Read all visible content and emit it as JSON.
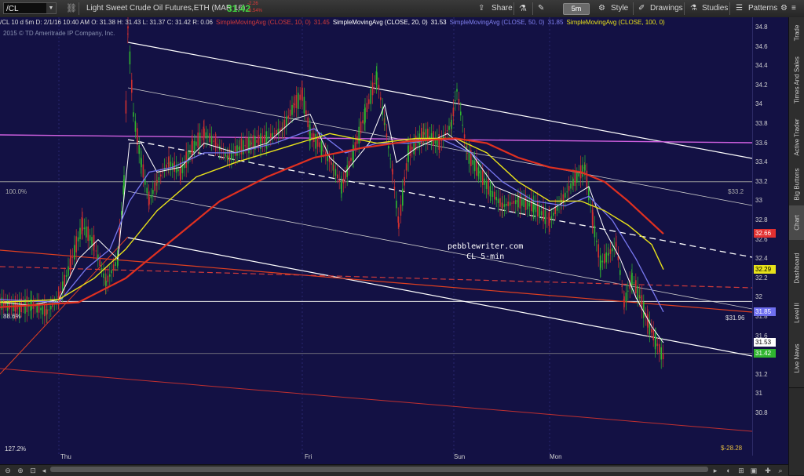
{
  "toolbar": {
    "symbol": "/CL",
    "description": "Light Sweet Crude Oil Futures,ETH (MAR 16)",
    "price": "31.42",
    "change_abs": "-2.26",
    "change_pct": "-6.54%",
    "share_label": "Share",
    "timeframe": "5m",
    "style_label": "Style",
    "drawings_label": "Drawings",
    "studies_label": "Studies",
    "patterns_label": "Patterns"
  },
  "infobar": {
    "ohlc": "/CL 10 d 5m  D: 2/1/16 10:40 AM  O: 31.38  H: 31.43  L: 31.37  C: 31.42  R: 0.06",
    "sma10": "SimpleMovingAvg (CLOSE, 10, 0)",
    "sma10_val": "31.45",
    "sma20": "SimpleMovingAvg (CLOSE, 20, 0)",
    "sma20_val": "31.53",
    "sma50": "SimpleMovingAvg (CLOSE, 50, 0)",
    "sma50_val": "31.85",
    "sma100": "SimpleMovingAvg (CLOSE, 100, 0)",
    "sma100_val": "32.66"
  },
  "copyright": "2015 © TD Ameritrade IP Company, Inc.",
  "watermark": {
    "line1": "pebblewriter.com",
    "line2": "CL 5-min"
  },
  "plot_labels": {
    "fib100": "100.0%",
    "fib886": "88.6%",
    "fib1272": "127.2%",
    "lvl332": "$33.2",
    "lvl3196": "$31.96",
    "pl": "$-28.28"
  },
  "yaxis": {
    "ticks": [
      "34.8",
      "34.6",
      "34.4",
      "34.2",
      "34",
      "33.8",
      "33.6",
      "33.4",
      "33.2",
      "33",
      "32.8",
      "32.6",
      "32.4",
      "32.2",
      "32",
      "31.8",
      "31.6",
      "31.4",
      "31.2",
      "31",
      "30.8"
    ],
    "badges": [
      {
        "text": "32.66",
        "color": "#e23030",
        "fg": "#ffffff"
      },
      {
        "text": "32.29",
        "color": "#e8e21a",
        "fg": "#000000"
      },
      {
        "text": "31.85",
        "color": "#6f6ff0",
        "fg": "#ffffff"
      },
      {
        "text": "31.53",
        "color": "#ffffff",
        "fg": "#000000"
      },
      {
        "text": "31.42",
        "color": "#2fb52f",
        "fg": "#ffffff"
      }
    ]
  },
  "xaxis": {
    "labels": [
      "Thu",
      "Fri",
      "Sun",
      "Mon"
    ]
  },
  "right_tabs": [
    "Trade",
    "Times And Sales",
    "Active Trader",
    "Big Buttons",
    "Chart",
    "Dashboard",
    "Level II",
    "Live News"
  ],
  "active_tab": "Chart",
  "colors": {
    "background": "#131144",
    "sma10": "#d03a3a",
    "sma20": "#ffffff",
    "sma50": "#7878f0",
    "sma100": "#e8e21a",
    "up": "#2fb52f",
    "down": "#d03030"
  }
}
